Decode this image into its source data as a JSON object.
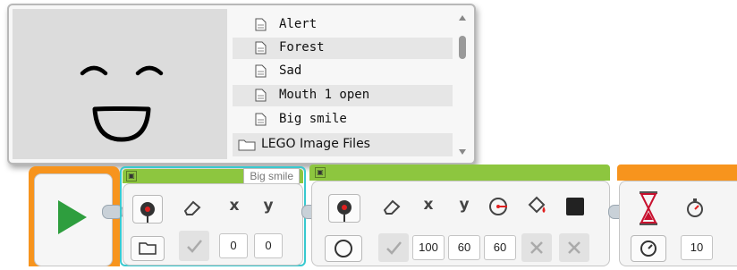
{
  "image_browser": {
    "files": [
      {
        "label": "Alert"
      },
      {
        "label": "Forest",
        "shaded": true
      },
      {
        "label": "Sad"
      },
      {
        "label": "Mouth 1 open",
        "shaded": true
      },
      {
        "label": "Big smile"
      }
    ],
    "folder": "LEGO Image Files"
  },
  "program": {
    "display_image": {
      "file_name": "Big smile",
      "x_value": "0",
      "y_value": "0",
      "x_icon": "x",
      "y_icon": "y"
    },
    "display_shape": {
      "x_value": "100",
      "y_value": "60",
      "radius_value": "60",
      "x_icon": "x",
      "y_icon": "y"
    },
    "wait": {
      "seconds_value": "10"
    }
  },
  "colors": {
    "block_green": "#8dc63f",
    "block_orange": "#f7941d",
    "start_green": "#2e9e3e",
    "selection_cyan": "#39c9cf"
  },
  "icons": [
    "document-icon",
    "folder-icon",
    "scroll-up-icon",
    "scroll-down-icon",
    "play-icon",
    "display-icon",
    "eraser-icon",
    "check-icon",
    "cross-icon",
    "circle-icon",
    "hourglass-icon",
    "timer-icon",
    "fill-bucket-icon",
    "color-swatch-icon",
    "radius-icon"
  ]
}
